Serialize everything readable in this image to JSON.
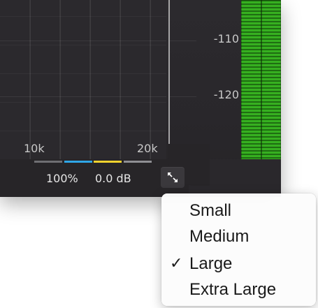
{
  "spectrum": {
    "freq_labels": [
      "10k",
      "20k"
    ]
  },
  "db_scale": {
    "labels": [
      "-110",
      "-120"
    ]
  },
  "status": {
    "zoom": "100%",
    "gain": "0.0 dB"
  },
  "band_colors": [
    "#6f6f73",
    "#2fa6e6",
    "#f2d22e",
    "#8f8f94"
  ],
  "meter_color": "#36b020",
  "resize_button": {
    "icon": "resize-arrows-icon"
  },
  "size_menu": {
    "items": [
      {
        "label": "Small",
        "checked": false
      },
      {
        "label": "Medium",
        "checked": false
      },
      {
        "label": "Large",
        "checked": true
      },
      {
        "label": "Extra Large",
        "checked": false
      }
    ],
    "check_glyph": "✓"
  }
}
